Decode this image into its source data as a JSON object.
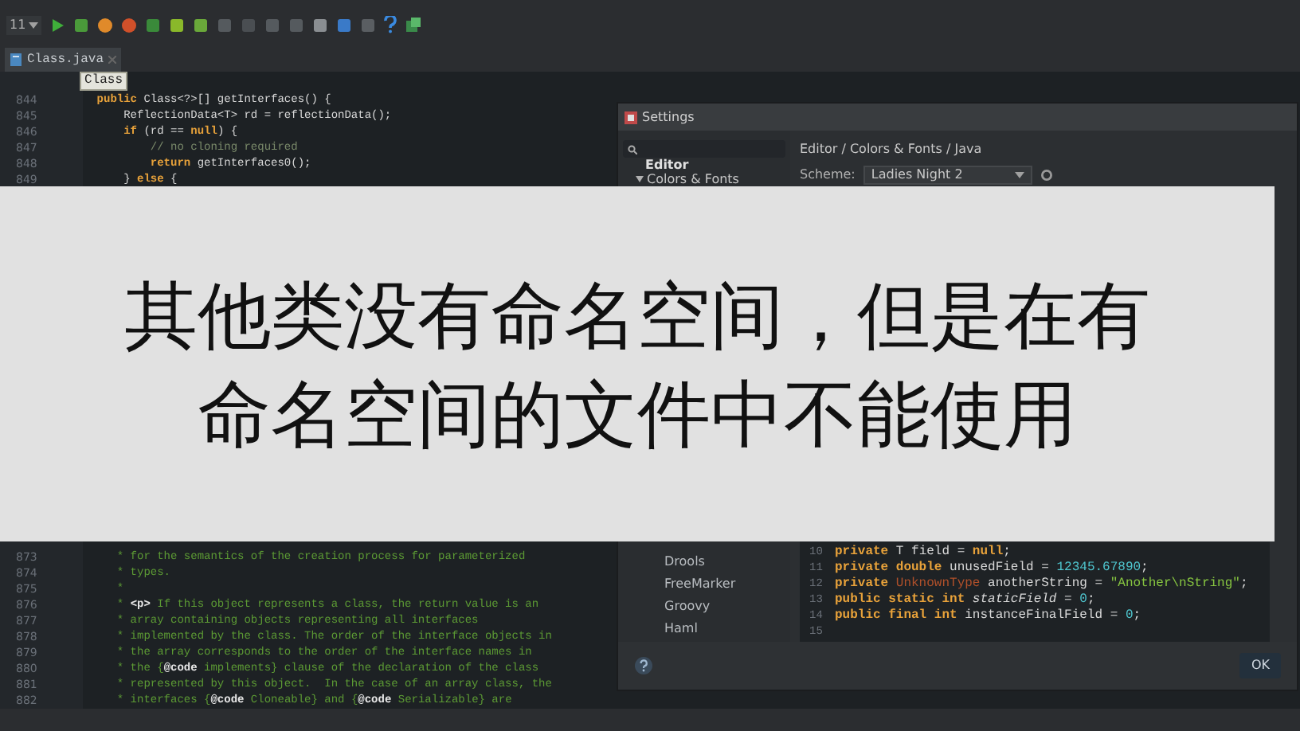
{
  "toolbar": {
    "combo": "11"
  },
  "tabs": [
    {
      "label": "Class.java",
      "selected": true
    }
  ],
  "tooltip": "Class",
  "editor": {
    "top_lines": [
      {
        "number": "844",
        "tokens": [
          {
            "text": "    public",
            "kind": "keyword"
          },
          {
            "text": " Class<?>[] getInterfaces() {",
            "kind": "plain"
          }
        ]
      },
      {
        "number": "845",
        "tokens": [
          {
            "text": "        ReflectionData<T> rd = reflectionData();",
            "kind": "plain"
          }
        ]
      },
      {
        "number": "846",
        "tokens": [
          {
            "text": "        if",
            "kind": "keyword"
          },
          {
            "text": " (rd == ",
            "kind": "plain"
          },
          {
            "text": "null",
            "kind": "keyword"
          },
          {
            "text": ") {",
            "kind": "plain"
          }
        ]
      },
      {
        "number": "847",
        "tokens": [
          {
            "text": "            // no cloning required",
            "kind": "comment"
          }
        ]
      },
      {
        "number": "848",
        "tokens": [
          {
            "text": "            return",
            "kind": "keyword"
          },
          {
            "text": " getInterfaces0();",
            "kind": "plain"
          }
        ]
      },
      {
        "number": "849",
        "tokens": [
          {
            "text": "        } ",
            "kind": "plain"
          },
          {
            "text": "else",
            "kind": "keyword"
          },
          {
            "text": " {",
            "kind": "plain"
          }
        ]
      }
    ],
    "bottom_lines": [
      {
        "number": "873",
        "tokens": [
          {
            "text": "       * for the semantics of the creation process for parameterized",
            "kind": "doc"
          }
        ]
      },
      {
        "number": "874",
        "tokens": [
          {
            "text": "       * types.",
            "kind": "doc"
          }
        ]
      },
      {
        "number": "875",
        "tokens": [
          {
            "text": "       *",
            "kind": "doc"
          }
        ]
      },
      {
        "number": "876",
        "tokens": [
          {
            "text": "       * ",
            "kind": "doc"
          },
          {
            "text": "<p>",
            "kind": "tag"
          },
          {
            "text": " If this object represents a class, the return value is an",
            "kind": "doc"
          }
        ]
      },
      {
        "number": "877",
        "tokens": [
          {
            "text": "       * array containing objects representing all interfaces",
            "kind": "doc"
          }
        ]
      },
      {
        "number": "878",
        "tokens": [
          {
            "text": "       * implemented by the class. The order of the interface objects in",
            "kind": "doc"
          }
        ]
      },
      {
        "number": "879",
        "tokens": [
          {
            "text": "       * the array corresponds to the order of the interface names in",
            "kind": "doc"
          }
        ]
      },
      {
        "number": "880",
        "tokens": [
          {
            "text": "       * the {",
            "kind": "doc"
          },
          {
            "text": "@code",
            "kind": "tag"
          },
          {
            "text": " implements} clause of the declaration of the class",
            "kind": "doc"
          }
        ]
      },
      {
        "number": "881",
        "tokens": [
          {
            "text": "       * represented by this object.  In the case of an array class, the",
            "kind": "doc"
          }
        ]
      },
      {
        "number": "882",
        "tokens": [
          {
            "text": "       * interfaces {",
            "kind": "doc"
          },
          {
            "text": "@code",
            "kind": "tag"
          },
          {
            "text": " Cloneable} and {",
            "kind": "doc"
          },
          {
            "text": "@code",
            "kind": "tag"
          },
          {
            "text": " Serializable} are",
            "kind": "doc"
          }
        ]
      }
    ]
  },
  "settings": {
    "title": "Settings",
    "tree": [
      {
        "label": "Editor",
        "children": [
          {
            "label": "Colors & Fonts",
            "expanded": true,
            "children": [
              {
                "label": "Drools"
              },
              {
                "label": "FreeMarker"
              },
              {
                "label": "Groovy"
              },
              {
                "label": "Haml"
              }
            ]
          }
        ]
      }
    ],
    "breadcrumb": "Editor / Colors & Fonts / Java",
    "scheme_label": "Scheme:",
    "scheme_value": "Ladies Night 2",
    "preview_lines": [
      {
        "number": "10",
        "tokens": [
          {
            "text": "private",
            "kind": "keyword"
          },
          {
            "text": " T field = ",
            "kind": "plain"
          },
          {
            "text": "null",
            "kind": "keyword"
          },
          {
            "text": ";",
            "kind": "plain"
          }
        ]
      },
      {
        "number": "11",
        "tokens": [
          {
            "text": "private double",
            "kind": "keyword"
          },
          {
            "text": " unusedField = ",
            "kind": "plain"
          },
          {
            "text": "12345.67890",
            "kind": "number"
          },
          {
            "text": ";",
            "kind": "plain"
          }
        ]
      },
      {
        "number": "12",
        "tokens": [
          {
            "text": "private ",
            "kind": "keyword"
          },
          {
            "text": "UnknownType",
            "kind": "error"
          },
          {
            "text": " anotherString = ",
            "kind": "plain"
          },
          {
            "text": "\"Another\\nString\"",
            "kind": "string"
          },
          {
            "text": ";",
            "kind": "plain"
          }
        ]
      },
      {
        "number": "13",
        "tokens": [
          {
            "text": "public static int ",
            "kind": "keyword"
          },
          {
            "text": "staticField",
            "kind": "italic"
          },
          {
            "text": " = ",
            "kind": "plain"
          },
          {
            "text": "0",
            "kind": "number"
          },
          {
            "text": ";",
            "kind": "plain"
          }
        ]
      },
      {
        "number": "14",
        "tokens": [
          {
            "text": "public final int",
            "kind": "keyword"
          },
          {
            "text": " instanceFinalField = ",
            "kind": "plain"
          },
          {
            "text": "0",
            "kind": "number"
          },
          {
            "text": ";",
            "kind": "plain"
          }
        ]
      },
      {
        "number": "15"
      }
    ],
    "ok_button": "OK"
  },
  "banner": [
    "其他类没有命名空间，但是在有",
    "命名空间的文件中不能使用"
  ]
}
